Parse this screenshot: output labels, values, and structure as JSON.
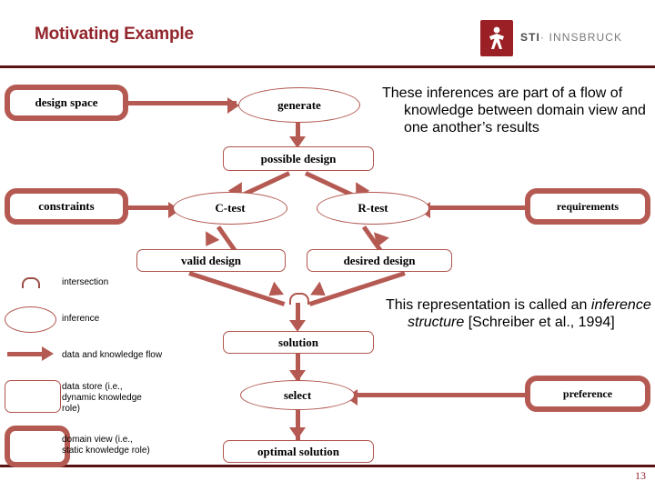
{
  "slide": {
    "title": "Motivating Example",
    "page_number": "13",
    "accent_color": "#b55a52",
    "title_color": "#93252c",
    "rule_color": "#5a1212"
  },
  "logo": {
    "mark_name": "sti-figure-icon",
    "text_bold": "STI",
    "text_sep": "·",
    "text_rest": "INNSBRUCK",
    "mark_color": "#9b2026"
  },
  "diagram": {
    "nodes": {
      "design_space": "design space",
      "generate": "generate",
      "possible_design": "possible design",
      "constraints": "constraints",
      "c_test": "C-test",
      "r_test": "R-test",
      "requirements": "requirements",
      "valid_design": "valid design",
      "desired_design": "desired design",
      "solution": "solution",
      "select": "select",
      "optimal_solution": "optimal solution",
      "preference": "preference"
    }
  },
  "notes": {
    "note1": "These inferences are part of a flow of knowledge between domain view and one another’s results",
    "note2_lead": "This representation is called an",
    "note2_italic": "inference structure",
    "note2_cite": "[Schreiber et al., 1994]"
  },
  "legend": {
    "items": [
      {
        "shape": "intersection-symbol",
        "label": "intersection"
      },
      {
        "shape": "ellipse",
        "label": "inference"
      },
      {
        "shape": "arrow",
        "label": "data and knowledge flow"
      },
      {
        "shape": "thin-rounded-rect",
        "label": "data store (i.e., dynamic knowledge role)"
      },
      {
        "shape": "thick-rounded-rect",
        "label": "domain view (i.e., static knowledge role)"
      }
    ],
    "item3_l1": "data store (i.e.,",
    "item3_l2": "dynamic knowledge",
    "item3_l3": "role)",
    "item4_l1": "domain view (i.e.,",
    "item4_l2": "static knowledge role)"
  }
}
